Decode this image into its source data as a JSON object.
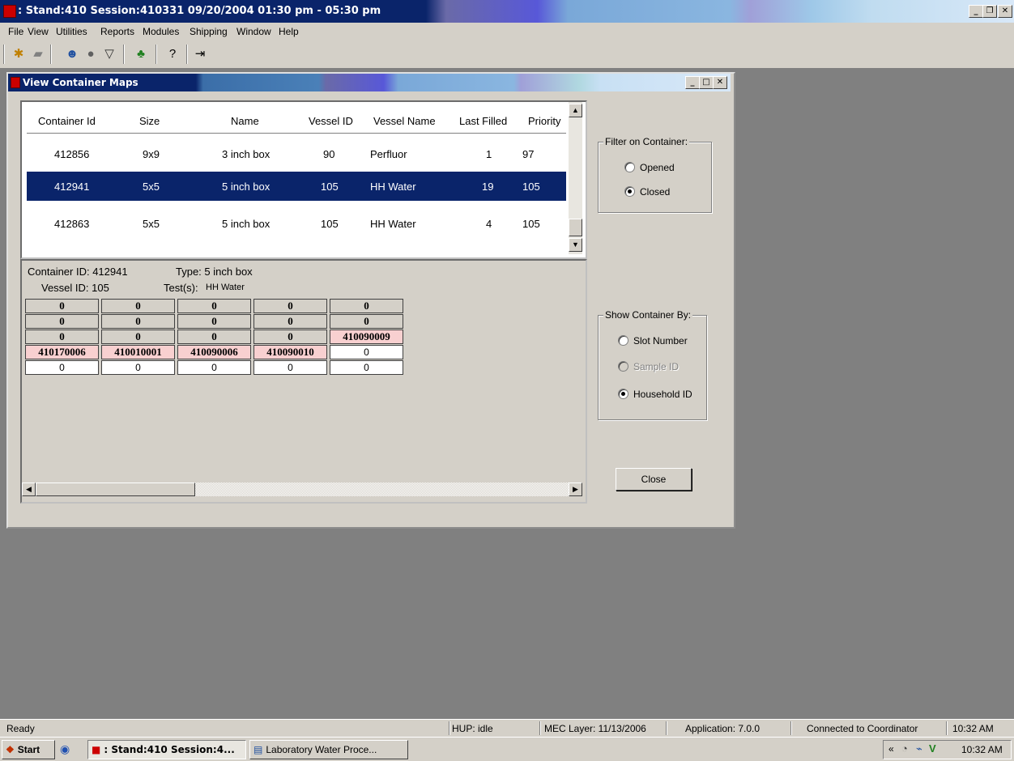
{
  "window": {
    "title": ": Stand:410 Session:410331 09/20/2004 01:30 pm - 05:30 pm"
  },
  "menu": [
    "File",
    "View",
    "Utilities",
    "Reports",
    "Modules",
    "Shipping",
    "Window",
    "Help"
  ],
  "child": {
    "title": "View Container Maps"
  },
  "list": {
    "headers": [
      "Container Id",
      "Size",
      "Name",
      "Vessel ID",
      "Vessel Name",
      "Last Filled",
      "Priority"
    ],
    "rows": [
      [
        "412856",
        "9x9",
        "3 inch box",
        "90",
        "Perfluor",
        "1",
        "97"
      ],
      [
        "412941",
        "5x5",
        "5 inch box",
        "105",
        "HH Water",
        "19",
        "105"
      ],
      [
        "412863",
        "5x5",
        "5 inch box",
        "105",
        "HH Water",
        "4",
        "105"
      ]
    ],
    "selected_row": 1
  },
  "detail": {
    "container_id_label": "Container ID: 412941",
    "type_label": "Type: 5 inch box",
    "vessel_id_label": "Vessel ID: 105",
    "tests_label": "Test(s):",
    "tests_value": "HH Water"
  },
  "grid": [
    [
      "0",
      "0",
      "0",
      "0",
      "0"
    ],
    [
      "0",
      "0",
      "0",
      "0",
      "0"
    ],
    [
      "0",
      "0",
      "0",
      "0",
      "410090009"
    ],
    [
      "410170006",
      "410010001",
      "410090006",
      "410090010",
      "0"
    ],
    [
      "0",
      "0",
      "0",
      "0",
      "0"
    ]
  ],
  "filter_group": {
    "title": "Filter on Container:",
    "opened": "Opened",
    "closed": "Closed",
    "selected": "closed"
  },
  "show_group": {
    "title": "Show Container By:",
    "slot": "Slot Number",
    "sample": "Sample ID",
    "household": "Household ID",
    "selected": "household"
  },
  "close_button": "Close",
  "status": {
    "ready": "Ready",
    "hup": "HUP: idle",
    "mec": "MEC Layer: 11/13/2006",
    "app": "Application: 7.0.0",
    "conn": "Connected to Coordinator",
    "time": "10:32 AM"
  },
  "taskbar": {
    "start": "Start",
    "task1": ": Stand:410 Session:4...",
    "task2": "Laboratory Water Proce...",
    "clock": "10:32 AM"
  }
}
